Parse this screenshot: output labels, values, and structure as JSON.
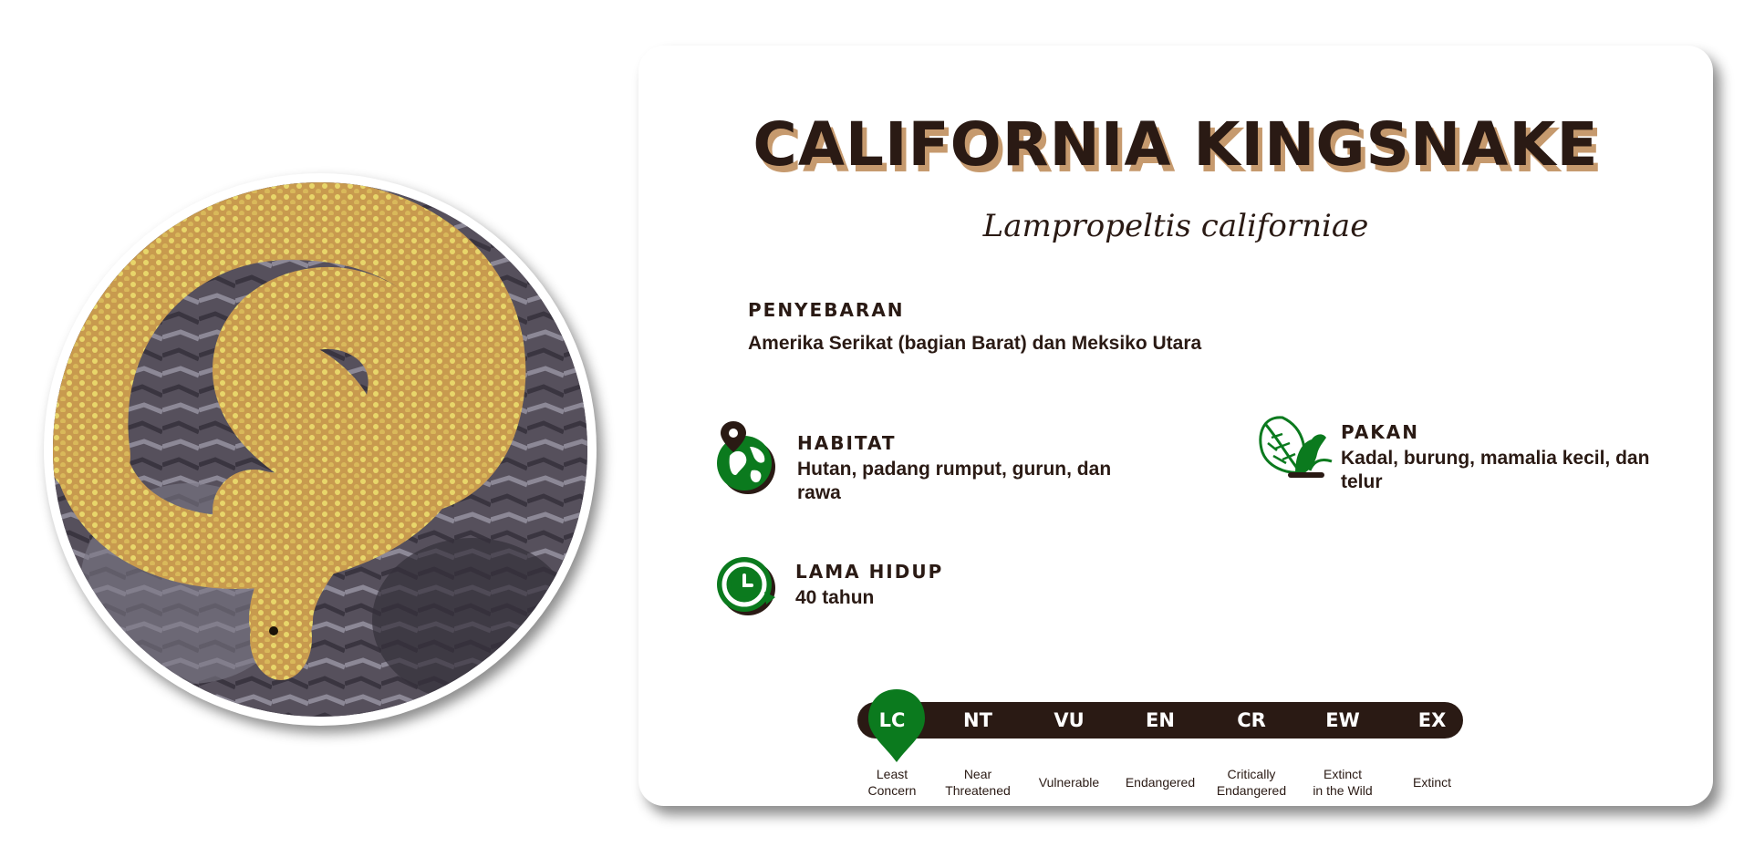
{
  "species": {
    "common_name": "CALIFORNIA KINGSNAKE",
    "scientific_name": "Lampropeltis californiae"
  },
  "distribution": {
    "label": "PENYEBARAN",
    "value": "Amerika Serikat (bagian Barat) dan Meksiko Utara"
  },
  "habitat": {
    "label": "HABITAT",
    "value": "Hutan, padang rumput, gurun, dan rawa",
    "icon": "globe-pin-icon"
  },
  "diet": {
    "label": "PAKAN",
    "value": "Kadal, burung, mamalia kecil, dan telur",
    "icon": "leaf-icon"
  },
  "lifespan": {
    "label": "LAMA HIDUP",
    "value": "40 tahun",
    "icon": "clock-icon"
  },
  "conservation": {
    "active": "LC",
    "statuses": [
      {
        "code": "LC",
        "name": "Least\nConcern"
      },
      {
        "code": "NT",
        "name": "Near\nThreatened"
      },
      {
        "code": "VU",
        "name": "Vulnerable"
      },
      {
        "code": "EN",
        "name": "Endangered"
      },
      {
        "code": "CR",
        "name": "Critically\nEndangered"
      },
      {
        "code": "EW",
        "name": "Extinct\nin the Wild"
      },
      {
        "code": "EX",
        "name": "Extinct"
      }
    ]
  },
  "colors": {
    "dark_brown": "#2a1a14",
    "title_shadow": "#c69a6e",
    "green": "#0b7a1e"
  }
}
